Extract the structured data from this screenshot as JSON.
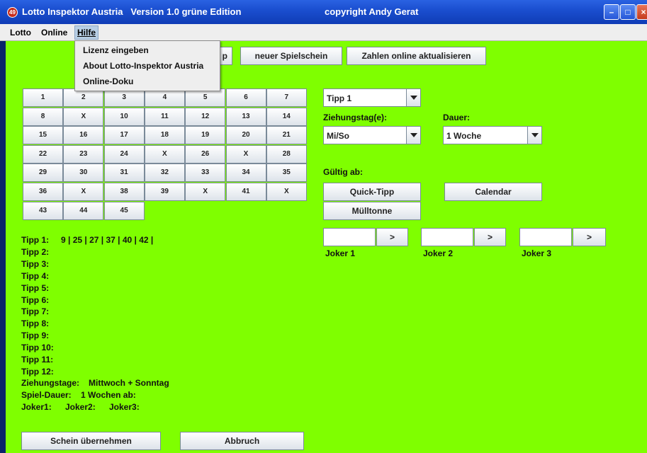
{
  "window": {
    "icon_text": "49",
    "title": "Lotto Inspektor Austria   Version 1.0 grüne Edition",
    "copyright": "copyright Andy Gerat",
    "controls": {
      "min": "–",
      "max": "□",
      "close": "×"
    }
  },
  "menubar": {
    "lotto": "Lotto",
    "online": "Online",
    "hilfe": "Hilfe"
  },
  "hilfe_menu": {
    "items": [
      "Lizenz eingeben",
      "About Lotto-Inspektor Austria",
      "Online-Doku"
    ]
  },
  "toolbar": {
    "hidden_button_tail": "p",
    "new_ticket": "neuer Spielschein",
    "update_online": "Zahlen online aktualisieren"
  },
  "grid": {
    "rows": [
      [
        "1",
        "2",
        "3",
        "4",
        "5",
        "6",
        "7"
      ],
      [
        "8",
        "X",
        "10",
        "11",
        "12",
        "13",
        "14"
      ],
      [
        "15",
        "16",
        "17",
        "18",
        "19",
        "20",
        "21"
      ],
      [
        "22",
        "23",
        "24",
        "X",
        "26",
        "X",
        "28"
      ],
      [
        "29",
        "30",
        "31",
        "32",
        "33",
        "34",
        "35"
      ],
      [
        "36",
        "X",
        "38",
        "39",
        "X",
        "41",
        "X"
      ],
      [
        "43",
        "44",
        "45"
      ]
    ]
  },
  "controls": {
    "tipp_select": "Tipp 1",
    "ziehungstag_label": "Ziehungstag(e):",
    "ziehungstag_select": "Mi/So",
    "dauer_label": "Dauer:",
    "dauer_select": "1 Woche",
    "gueltig_label": "Gültig ab:",
    "quick_tipp": "Quick-Tipp",
    "calendar": "Calendar",
    "muelltonne": "Mülltonne"
  },
  "joker": {
    "arrow": ">",
    "labels": [
      "Joker 1",
      "Joker 2",
      "Joker 3"
    ]
  },
  "summary": {
    "tipps": [
      {
        "label": "Tipp 1:",
        "value": "9 | 25 | 27 | 37 | 40 | 42 |"
      },
      {
        "label": "Tipp 2:",
        "value": ""
      },
      {
        "label": "Tipp 3:",
        "value": ""
      },
      {
        "label": "Tipp 4:",
        "value": ""
      },
      {
        "label": "Tipp 5:",
        "value": ""
      },
      {
        "label": "Tipp 6:",
        "value": ""
      },
      {
        "label": "Tipp 7:",
        "value": ""
      },
      {
        "label": "Tipp 8:",
        "value": ""
      },
      {
        "label": "Tipp 9:",
        "value": ""
      },
      {
        "label": "Tipp 10:",
        "value": ""
      },
      {
        "label": "Tipp 11:",
        "value": ""
      },
      {
        "label": "Tipp 12:",
        "value": ""
      }
    ],
    "ziehungstage_label": "Ziehungstage:",
    "ziehungstage_value": "Mittwoch + Sonntag",
    "dauer_label": "Spiel-Dauer:",
    "dauer_value": "1 Wochen ab:",
    "joker1": "Joker1:",
    "joker2": "Joker2:",
    "joker3": "Joker3:"
  },
  "footer": {
    "accept": "Schein übernehmen",
    "cancel": "Abbruch"
  }
}
